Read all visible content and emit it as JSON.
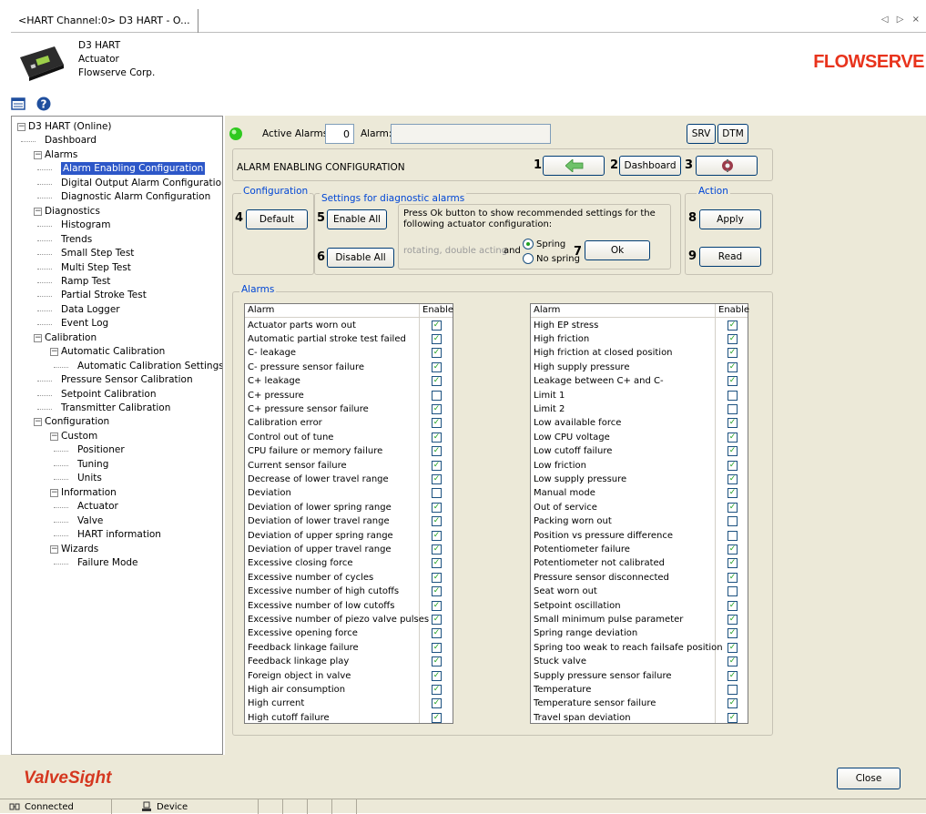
{
  "tab": {
    "title": "<HART Channel:0> D3 HART - O...",
    "nav": "◁ ▷ ×"
  },
  "device": {
    "line1": "D3 HART",
    "line2": "Actuator",
    "line3": "Flowserve Corp.",
    "logo": "FLOWSERVE"
  },
  "tree": [
    {
      "label": "D3 HART (Online)",
      "level": 0,
      "exp": "−"
    },
    {
      "label": "Dashboard",
      "level": 1
    },
    {
      "label": "Alarms",
      "level": 1,
      "exp": "−"
    },
    {
      "label": "Alarm Enabling Configuration",
      "level": 2,
      "selected": true
    },
    {
      "label": "Digital Output Alarm Configuration",
      "level": 2
    },
    {
      "label": "Diagnostic Alarm Configuration",
      "level": 2
    },
    {
      "label": "Diagnostics",
      "level": 1,
      "exp": "−"
    },
    {
      "label": "Histogram",
      "level": 2
    },
    {
      "label": "Trends",
      "level": 2
    },
    {
      "label": "Small Step Test",
      "level": 2
    },
    {
      "label": "Multi Step Test",
      "level": 2
    },
    {
      "label": "Ramp Test",
      "level": 2
    },
    {
      "label": "Partial Stroke Test",
      "level": 2
    },
    {
      "label": "Data Logger",
      "level": 2
    },
    {
      "label": "Event Log",
      "level": 2
    },
    {
      "label": "Calibration",
      "level": 1,
      "exp": "−"
    },
    {
      "label": "Automatic Calibration",
      "level": 2,
      "exp": "−"
    },
    {
      "label": "Automatic Calibration Settings",
      "level": 3
    },
    {
      "label": "Pressure Sensor Calibration",
      "level": 2
    },
    {
      "label": "Setpoint Calibration",
      "level": 2
    },
    {
      "label": "Transmitter Calibration",
      "level": 2
    },
    {
      "label": "Configuration",
      "level": 1,
      "exp": "−"
    },
    {
      "label": "Custom",
      "level": 2,
      "exp": "−"
    },
    {
      "label": "Positioner",
      "level": 3
    },
    {
      "label": "Tuning",
      "level": 3
    },
    {
      "label": "Units",
      "level": 3
    },
    {
      "label": "Information",
      "level": 2,
      "exp": "−"
    },
    {
      "label": "Actuator",
      "level": 3
    },
    {
      "label": "Valve",
      "level": 3
    },
    {
      "label": "HART information",
      "level": 3
    },
    {
      "label": "Wizards",
      "level": 2,
      "exp": "−"
    },
    {
      "label": "Failure Mode",
      "level": 3
    }
  ],
  "header": {
    "active_alarms_label": "Active Alarms:",
    "active_alarms_count": "0",
    "alarm_label": "Alarm:",
    "alarm_value": "",
    "srv": "SRV",
    "dtm": "DTM"
  },
  "section_title": "ALARM ENABLING CONFIGURATION",
  "callouts": {
    "n1": "1",
    "n2": "2",
    "n3": "3",
    "n4": "4",
    "n5": "5",
    "n6": "6",
    "n7": "7",
    "n8": "8",
    "n9": "9"
  },
  "buttons": {
    "dashboard": "Dashboard",
    "default": "Default",
    "enable_all": "Enable All",
    "disable_all": "Disable All",
    "ok": "Ok",
    "apply": "Apply",
    "read": "Read",
    "close": "Close"
  },
  "groups": {
    "configuration": "Configuration",
    "settings": "Settings for diagnostic alarms",
    "action": "Action",
    "alarms": "Alarms"
  },
  "settings": {
    "instruction": "Press Ok button to show recommended settings for the following actuator configuration:",
    "config_text": "rotating, double acting",
    "and": "and",
    "spring": "Spring",
    "no_spring": "No spring",
    "selected": "Spring"
  },
  "table_headers": {
    "alarm": "Alarm",
    "enable": "Enable"
  },
  "alarms_left": [
    {
      "name": "Actuator parts worn out",
      "enabled": true
    },
    {
      "name": "Automatic partial stroke test failed",
      "enabled": true
    },
    {
      "name": "C- leakage",
      "enabled": true
    },
    {
      "name": "C- pressure sensor failure",
      "enabled": true
    },
    {
      "name": "C+ leakage",
      "enabled": true
    },
    {
      "name": "C+ pressure",
      "enabled": false
    },
    {
      "name": "C+ pressure sensor failure",
      "enabled": true
    },
    {
      "name": "Calibration error",
      "enabled": true
    },
    {
      "name": "Control out of tune",
      "enabled": true
    },
    {
      "name": "CPU failure or memory failure",
      "enabled": true
    },
    {
      "name": "Current sensor failure",
      "enabled": true
    },
    {
      "name": "Decrease of lower travel range",
      "enabled": true
    },
    {
      "name": "Deviation",
      "enabled": false
    },
    {
      "name": "Deviation of lower spring range",
      "enabled": true
    },
    {
      "name": "Deviation of lower travel range",
      "enabled": true
    },
    {
      "name": "Deviation of upper spring range",
      "enabled": true
    },
    {
      "name": "Deviation of upper travel range",
      "enabled": true
    },
    {
      "name": "Excessive closing force",
      "enabled": true
    },
    {
      "name": "Excessive number of cycles",
      "enabled": true
    },
    {
      "name": "Excessive number of high cutoffs",
      "enabled": true
    },
    {
      "name": "Excessive number of low cutoffs",
      "enabled": true
    },
    {
      "name": "Excessive number of piezo valve pulses",
      "enabled": true
    },
    {
      "name": "Excessive opening force",
      "enabled": true
    },
    {
      "name": "Feedback linkage failure",
      "enabled": true
    },
    {
      "name": "Feedback linkage play",
      "enabled": true
    },
    {
      "name": "Foreign object in valve",
      "enabled": true
    },
    {
      "name": "High air consumption",
      "enabled": true
    },
    {
      "name": "High current",
      "enabled": true
    },
    {
      "name": "High cutoff failure",
      "enabled": true
    }
  ],
  "alarms_right": [
    {
      "name": "High EP stress",
      "enabled": true
    },
    {
      "name": "High friction",
      "enabled": true
    },
    {
      "name": "High friction at closed position",
      "enabled": true
    },
    {
      "name": "High supply pressure",
      "enabled": true
    },
    {
      "name": "Leakage between C+ and C-",
      "enabled": true
    },
    {
      "name": "Limit 1",
      "enabled": false
    },
    {
      "name": "Limit 2",
      "enabled": false
    },
    {
      "name": "Low available force",
      "enabled": true
    },
    {
      "name": "Low CPU voltage",
      "enabled": true
    },
    {
      "name": "Low cutoff failure",
      "enabled": true
    },
    {
      "name": "Low friction",
      "enabled": true
    },
    {
      "name": "Low supply pressure",
      "enabled": true
    },
    {
      "name": "Manual mode",
      "enabled": true
    },
    {
      "name": "Out of service",
      "enabled": true
    },
    {
      "name": "Packing worn out",
      "enabled": false
    },
    {
      "name": "Position vs pressure difference",
      "enabled": false
    },
    {
      "name": "Potentiometer failure",
      "enabled": true
    },
    {
      "name": "Potentiometer not calibrated",
      "enabled": true
    },
    {
      "name": "Pressure sensor disconnected",
      "enabled": true
    },
    {
      "name": "Seat worn out",
      "enabled": false
    },
    {
      "name": "Setpoint oscillation",
      "enabled": true
    },
    {
      "name": "Small minimum pulse parameter",
      "enabled": true
    },
    {
      "name": "Spring range deviation",
      "enabled": true
    },
    {
      "name": "Spring too weak to reach failsafe position",
      "enabled": true
    },
    {
      "name": "Stuck valve",
      "enabled": true
    },
    {
      "name": "Supply pressure sensor failure",
      "enabled": true
    },
    {
      "name": "Temperature",
      "enabled": false
    },
    {
      "name": "Temperature sensor failure",
      "enabled": true
    },
    {
      "name": "Travel span deviation",
      "enabled": true
    }
  ],
  "footer": {
    "brand": "ValveSight"
  },
  "status": {
    "connected": "Connected",
    "device": "Device"
  },
  "colors": {
    "selection": "#2d57c8",
    "group_title": "#0046d5",
    "brand": "#d5371f",
    "logo": "#e8331c",
    "checkmark": "#21a121",
    "panel": "#ece9d8"
  },
  "icons": {
    "led": "green-status-led",
    "back": "green-arrow-icon",
    "settings": "gear-icon",
    "menu": "panel-toggle-icon",
    "help": "help-icon",
    "connected": "connection-icon",
    "device": "device-icon"
  }
}
